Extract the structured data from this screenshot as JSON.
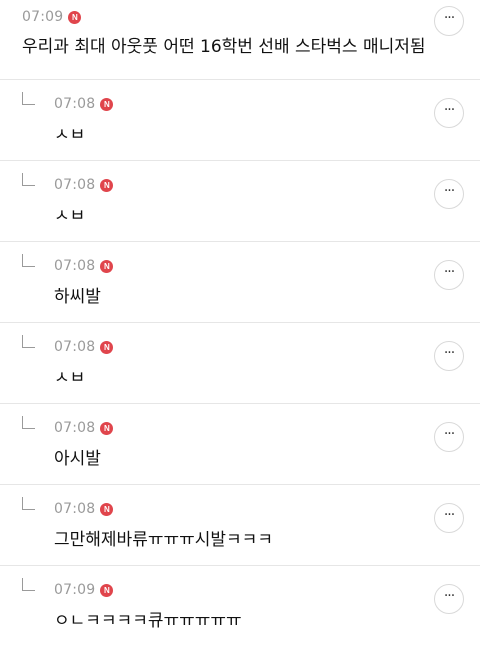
{
  "posts": [
    {
      "time": "07:09",
      "badge": "N",
      "text": "우리과 최대 아웃풋 어떤 16학번 선배 스타벅스 매니저됨",
      "more": "···"
    },
    {
      "time": "07:08",
      "badge": "N",
      "text": "ㅅㅂ",
      "more": "···"
    },
    {
      "time": "07:08",
      "badge": "N",
      "text": "ㅅㅂ",
      "more": "···"
    },
    {
      "time": "07:08",
      "badge": "N",
      "text": "하씨발",
      "more": "···"
    },
    {
      "time": "07:08",
      "badge": "N",
      "text": "ㅅㅂ",
      "more": "···"
    },
    {
      "time": "07:08",
      "badge": "N",
      "text": "아시발",
      "more": "···"
    },
    {
      "time": "07:08",
      "badge": "N",
      "text": "그만해제바류ㅠㅠㅠ시발ㅋㅋㅋ",
      "more": "···"
    },
    {
      "time": "07:09",
      "badge": "N",
      "text": "ㅇㄴㅋㅋㅋㅋ큐ㅠㅠㅠㅠㅠ",
      "more": "···"
    }
  ]
}
